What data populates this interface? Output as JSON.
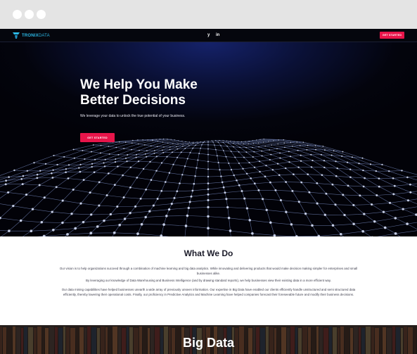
{
  "nav": {
    "brand_first": "TRONIX",
    "brand_second": "DATA",
    "social_twitter": "y",
    "social_linkedin": "in",
    "cta_label": "GET STARTED"
  },
  "hero": {
    "title_line1": "We Help You Make",
    "title_line2": "Better Decisions",
    "subtitle": "We leverage your data to unlock the true potential of your business.",
    "cta_label": "GET STARTED"
  },
  "what_we_do": {
    "title": "What We Do",
    "paragraph1": "Our vision is to help organizations succeed through a combination of machine learning and big data analytics. While innovating and delivering products that would make decision making simpler for enterprises and small businesses alike.",
    "paragraph2": "By leveraging our knowledge of Data Warehousing and Business Intelligence (and by drawing standard reports), we help businesses view their existing data in a more efficient way.",
    "paragraph3": "Our data mining capabilities have helped businesses unearth a wide array of previously unseen information. Our expertise in Big Data have enabled our clients efficiently handle unstructured and semi structured data efficiently, thereby lowering their operational costs. Finally, our proficiency in Predictive Analytics and Machine Learning have helped companies forecast their foreseeable future and modify their business decisions."
  },
  "big_data": {
    "title": "Big Data"
  },
  "colors": {
    "accent": "#e8154a",
    "brand": "#2bb8e6",
    "hero_dark": "#03040d",
    "mesh": "#9fb8ff"
  },
  "icons": {
    "twitter": "twitter-icon",
    "linkedin": "linkedin-icon",
    "logo": "tronix-logo-mark"
  }
}
